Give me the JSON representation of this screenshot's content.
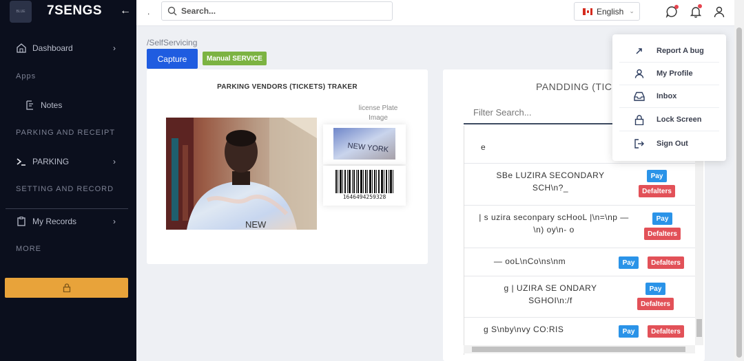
{
  "sidebar": {
    "brand": "7SENGS",
    "brand_logo_text": "BLUE",
    "items": [
      {
        "label": "Dashboard"
      },
      {
        "label": "Notes"
      },
      {
        "label": "PARKING"
      },
      {
        "label": "My Records"
      }
    ],
    "sections": [
      "Apps",
      "PARKING AND RECEIPT",
      "SETTING AND RECORD",
      "MORE"
    ]
  },
  "topbar": {
    "search_placeholder": "Search...",
    "language": "English"
  },
  "breadcrumb": "/SelfServicing",
  "actions": {
    "capture": "Capture",
    "manual": "Manual SERVICE"
  },
  "tracker": {
    "title": "PARKING VENDORS (TICKETS) TRAKER",
    "plate_label": "license Plate Image",
    "plate_text": "NEW YORK",
    "barcode_number": "1646494259328",
    "shirt_text": "NEW"
  },
  "pending": {
    "title": "PANDDING (TICKETS)",
    "filter_placeholder": "Filter Search...",
    "pay_label": "Pay",
    "defaulters_label": "Defalters",
    "rows": [
      {
        "text": "e"
      },
      {
        "text": "SBe LUZIRA SECONDARY SCH\\n?_"
      },
      {
        "text": "| s uzira seconpary scHooL |\\n=\\np —\\n) oy\\n- o"
      },
      {
        "text": "— ooL\\nCo\\ns\\nm"
      },
      {
        "text": "g | UZIRA SE ONDARY SGHOI\\n:/f"
      },
      {
        "text": "g S\\nby\\nvy CO:RIS"
      }
    ]
  },
  "user_menu": {
    "items": [
      {
        "label": "Report A bug",
        "icon": "arrow-up-right-icon"
      },
      {
        "label": "My Profile",
        "icon": "user-icon"
      },
      {
        "label": "Inbox",
        "icon": "inbox-icon"
      },
      {
        "label": "Lock Screen",
        "icon": "lock-icon"
      },
      {
        "label": "Sign Out",
        "icon": "sign-out-icon"
      }
    ]
  },
  "colors": {
    "sidebar_bg": "#0b0f1d",
    "primary": "#1f5ce0",
    "success": "#7cb342",
    "pay": "#2a93e8",
    "danger": "#e25158",
    "lock": "#e8a33a"
  }
}
